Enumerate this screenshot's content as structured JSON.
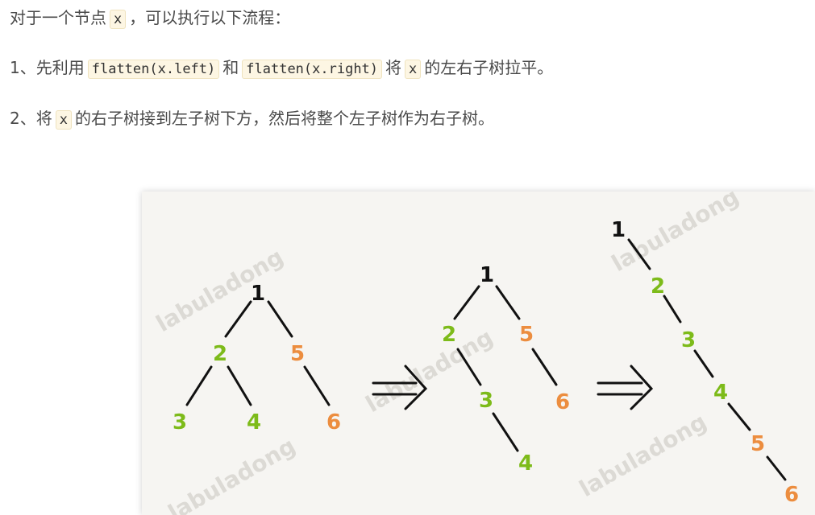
{
  "text": {
    "line1": {
      "a": "对于一个节点",
      "code1": "x",
      "b": "，可以执行以下流程："
    },
    "line2": {
      "a": "1、先利用",
      "code1": "flatten(x.left)",
      "b": "和",
      "code2": "flatten(x.right)",
      "c": "将",
      "code3": "x",
      "d": "的左右子树拉平。"
    },
    "line3": {
      "a": "2、将",
      "code1": "x",
      "b": "的右子树接到左子树下方，然后将整个左子树作为右子树。"
    }
  },
  "figure": {
    "watermark": "labuladong",
    "arrow_glyph": "⇒",
    "colors": {
      "root": "#111111",
      "left": "#7dbb1a",
      "right": "#ec8d3f",
      "edge": "#111111"
    },
    "tree1": {
      "n1": "1",
      "n2": "2",
      "n3": "3",
      "n4": "4",
      "n5": "5",
      "n6": "6"
    },
    "tree2": {
      "n1": "1",
      "n2": "2",
      "n3": "3",
      "n4": "4",
      "n5": "5",
      "n6": "6"
    },
    "tree3": {
      "n1": "1",
      "n2": "2",
      "n3": "3",
      "n4": "4",
      "n5": "5",
      "n6": "6"
    }
  }
}
